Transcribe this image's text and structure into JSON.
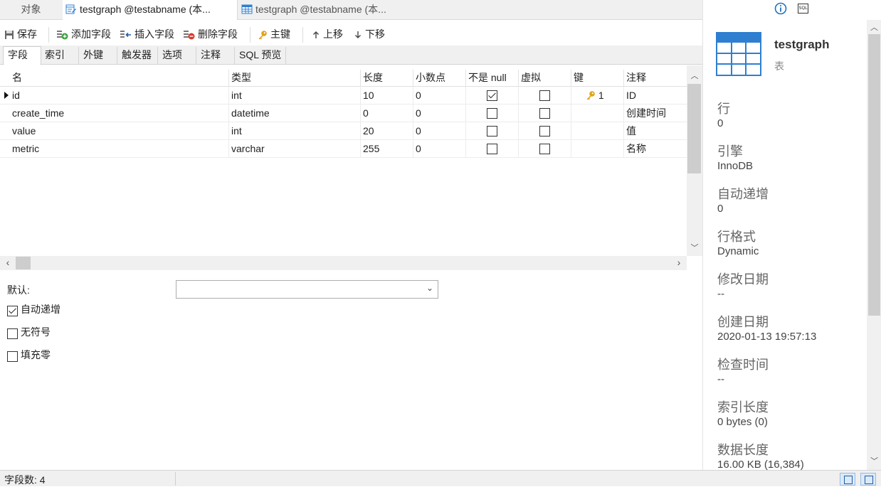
{
  "tabs": [
    {
      "label": "对象"
    },
    {
      "label": "testgraph @testabname (本..."
    },
    {
      "label": "testgraph @testabname (本..."
    }
  ],
  "toolbar": {
    "save": "保存",
    "add_field": "添加字段",
    "insert_field": "插入字段",
    "delete_field": "删除字段",
    "primary_key": "主键",
    "move_up": "上移",
    "move_down": "下移"
  },
  "subtabs": [
    "字段",
    "索引",
    "外键",
    "触发器",
    "选项",
    "注释",
    "SQL 预览"
  ],
  "grid": {
    "columns": [
      "名",
      "类型",
      "长度",
      "小数点",
      "不是 null",
      "虚拟",
      "键",
      "注释"
    ],
    "rows": [
      {
        "name": "id",
        "type": "int",
        "length": "10",
        "decimals": "0",
        "not_null": true,
        "virtual": false,
        "key": "1",
        "comment": "ID"
      },
      {
        "name": "create_time",
        "type": "datetime",
        "length": "0",
        "decimals": "0",
        "not_null": false,
        "virtual": false,
        "key": "",
        "comment": "创建时间"
      },
      {
        "name": "value",
        "type": "int",
        "length": "20",
        "decimals": "0",
        "not_null": false,
        "virtual": false,
        "key": "",
        "comment": "值"
      },
      {
        "name": "metric",
        "type": "varchar",
        "length": "255",
        "decimals": "0",
        "not_null": false,
        "virtual": false,
        "key": "",
        "comment": "名称"
      }
    ]
  },
  "field_options": {
    "default_label": "默认:",
    "default_value": "",
    "auto_increment_label": "自动递增",
    "auto_increment": true,
    "unsigned_label": "无符号",
    "unsigned": false,
    "zerofill_label": "填充零",
    "zerofill": false
  },
  "status": {
    "field_count": "字段数: 4"
  },
  "side": {
    "object_name": "testgraph",
    "object_type": "表",
    "sql_icon_text": "SQL",
    "info": [
      {
        "label": "行",
        "value": "0"
      },
      {
        "label": "引擎",
        "value": "InnoDB"
      },
      {
        "label": "自动递增",
        "value": "0"
      },
      {
        "label": "行格式",
        "value": "Dynamic"
      },
      {
        "label": "修改日期",
        "value": "--"
      },
      {
        "label": "创建日期",
        "value": "2020-01-13 19:57:13"
      },
      {
        "label": "检查时间",
        "value": "--"
      },
      {
        "label": "索引长度",
        "value": "0 bytes (0)"
      },
      {
        "label": "数据长度",
        "value": "16.00 KB (16,384)"
      }
    ]
  },
  "colors": {
    "accent": "#1e73be",
    "table_icon": "#2f7fd0"
  }
}
